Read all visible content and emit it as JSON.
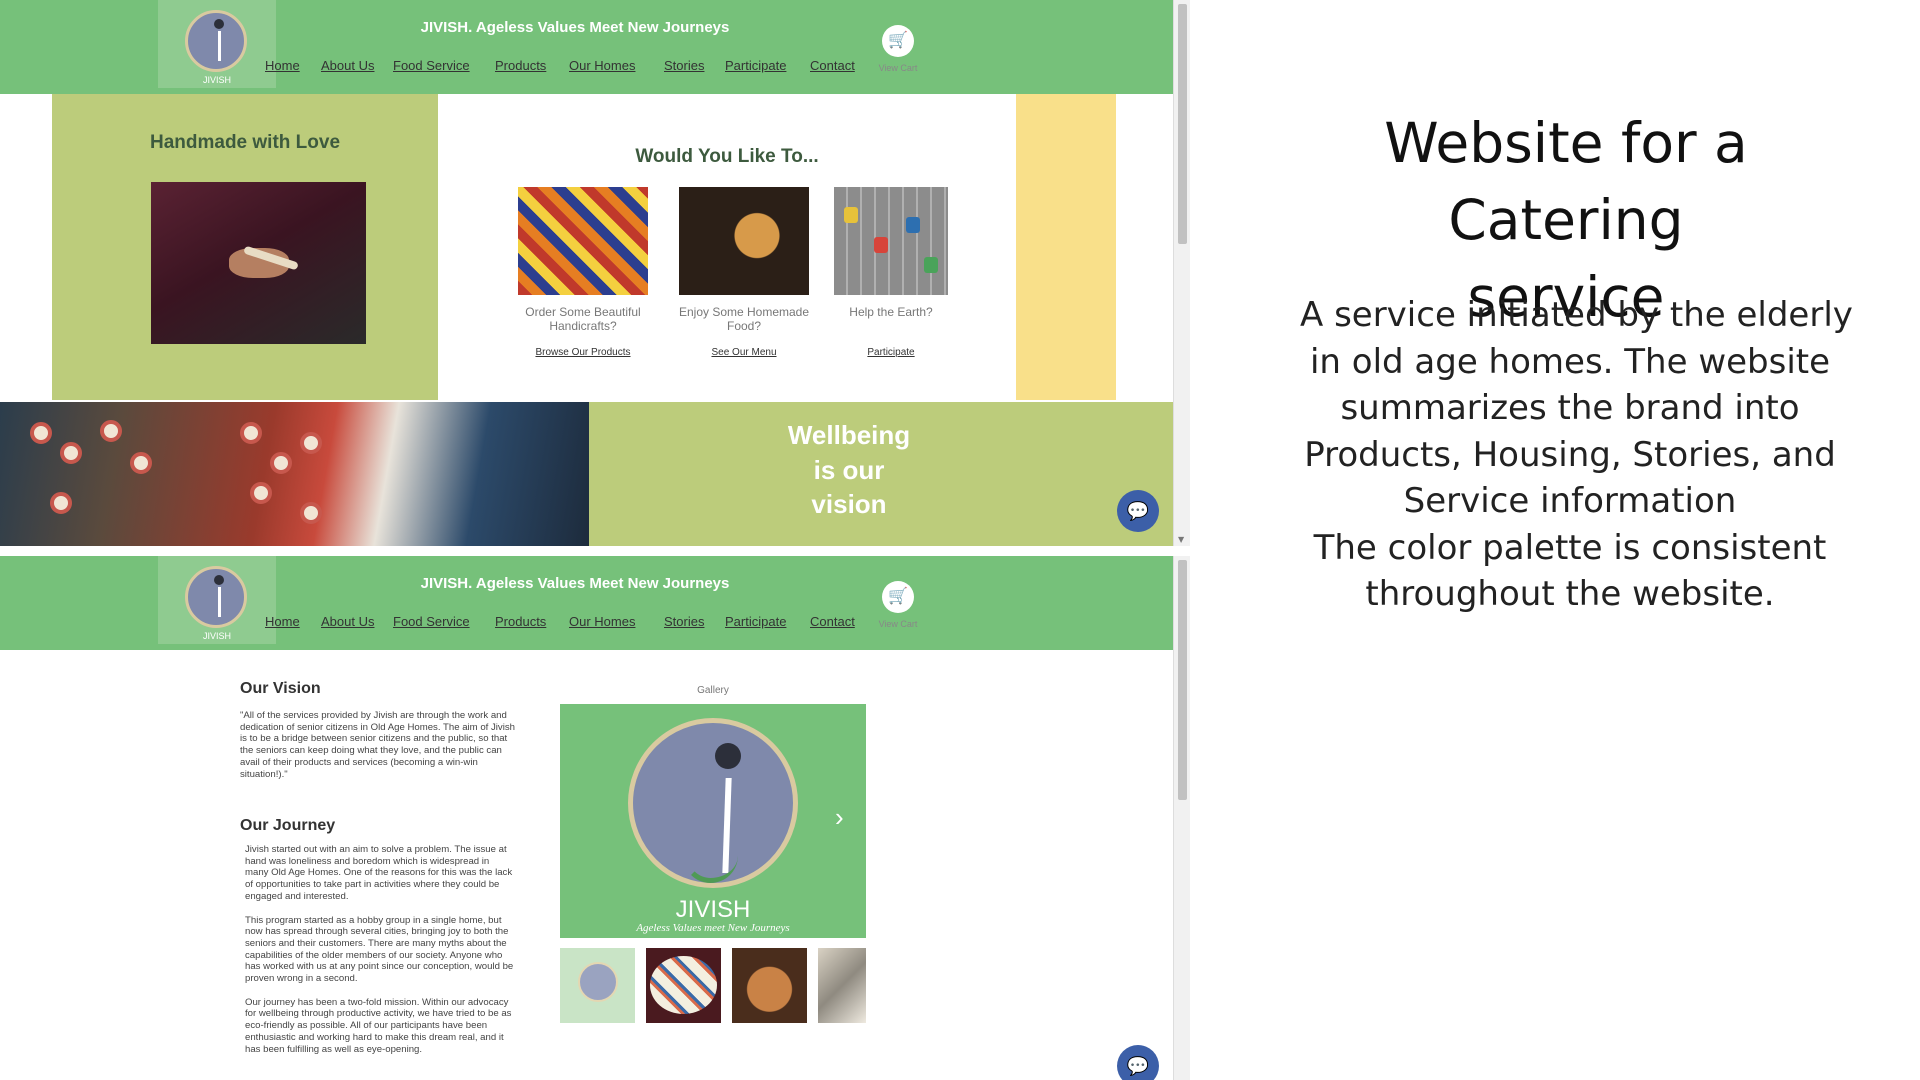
{
  "site": {
    "title": "JIVISH. Ageless Values Meet New Journeys",
    "logo_text": "JIVISH",
    "nav": [
      "Home",
      "About Us",
      "Food Service",
      "Products",
      "Our Homes",
      "Stories",
      "Participate",
      "Contact"
    ],
    "cart_label": "View Cart",
    "accent_green": "#76c17a",
    "olive": "#bccc7b",
    "yellow": "#f9e08a",
    "chat_icon": "chat-bubble-icon"
  },
  "home": {
    "handmade_heading": "Handmade with Love",
    "choices_heading": "Would You Like To...",
    "choices": [
      {
        "caption": "Order Some Beautiful Handicrafts?",
        "link": "Browse Our Products"
      },
      {
        "caption": "Enjoy Some Homemade Food?",
        "link": "See Our Menu"
      },
      {
        "caption": "Help the Earth?",
        "link": "Participate"
      }
    ],
    "banner_lines": [
      "Wellbeing",
      "is our",
      "vision"
    ]
  },
  "about": {
    "vision_title": "Our Vision",
    "vision_text": "\"All of the services provided by Jivish are through the work and dedication of senior citizens in Old Age Homes. The aim of Jivish is to be a bridge between senior citizens and the public, so that the seniors can keep doing what they love, and the public can avail of their products and services (becoming a win-win situation!).\"",
    "journey_title": "Our Journey",
    "journey_paragraphs": [
      "Jivish started out with an aim to solve a problem. The issue at hand was loneliness and boredom which is widespread in many Old Age Homes. One of the reasons for this was the lack of opportunities to take part in activities where they could be engaged and interested.",
      "This program started as a hobby group in a single home, but now has spread through several cities, bringing joy to both the seniors and their customers. There are many myths about the capabilities of the older members of our society. Anyone who has worked with us at any point since our conception, would be proven wrong in a second.",
      "Our journey has been a two-fold mission. Within our advocacy for wellbeing through productive activity, we have tried to be as eco-friendly as possible. All of our participants have been enthusiastic and working hard to make this dream real, and it has been fulfilling as well as eye-opening."
    ],
    "gallery_label": "Gallery",
    "gallery_brand": "JIVISH",
    "gallery_tagline": "Ageless Values meet New Journeys"
  },
  "description": {
    "title_lines": [
      "Website for a Catering",
      "service"
    ],
    "body_lines": [
      "A service initiated by the elderly",
      "in old age homes. The website",
      "summarizes the brand into",
      "Products, Housing, Stories, and",
      "Service information",
      "The color palette is consistent",
      "throughout the website."
    ]
  }
}
